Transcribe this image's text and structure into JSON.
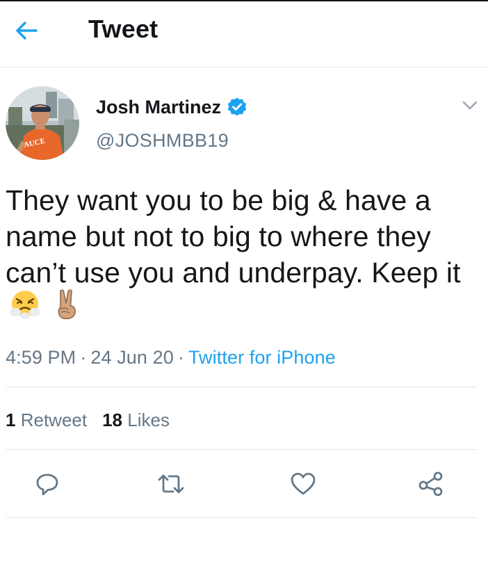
{
  "header": {
    "title": "Tweet",
    "back_icon": "arrow-left-icon"
  },
  "tweet": {
    "author": {
      "name": "Josh Martinez",
      "handle": "@JOSHMBB19",
      "verified": true,
      "avatar_shirt_text": "AUCE"
    },
    "text": "They want you to be big & have a name but not to big to where they can’t use you and underpay. Keep it",
    "emojis": [
      "face-with-steam-icon",
      "victory-hand-icon"
    ],
    "time": "4:59 PM",
    "date": "24 Jun 20",
    "separator": "·",
    "source": "Twitter for iPhone",
    "stats": {
      "retweets": "1",
      "retweets_label": "Retweet",
      "likes": "18",
      "likes_label": "Likes"
    }
  },
  "actions": [
    "reply-icon",
    "retweet-icon",
    "like-icon",
    "share-icon"
  ],
  "colors": {
    "accent": "#1da1f2",
    "text": "#14171a",
    "secondary": "#657786",
    "divider": "#e1e8ed"
  }
}
